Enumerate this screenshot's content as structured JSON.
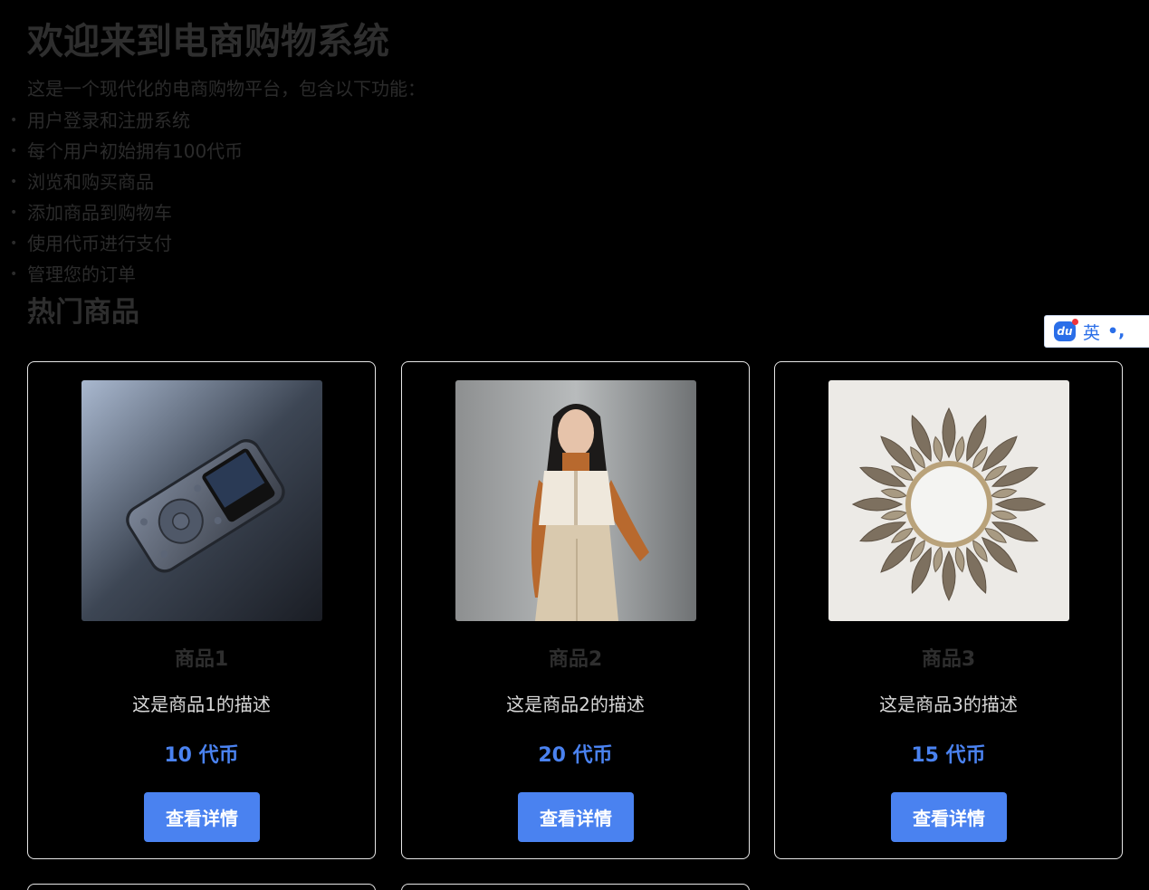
{
  "hero": {
    "title": "欢迎来到电商购物系统",
    "intro": "这是一个现代化的电商购物平台，包含以下功能：",
    "features": [
      "用户登录和注册系统",
      "每个用户初始拥有100代币",
      "浏览和购买商品",
      "添加商品到购物车",
      "使用代币进行支付",
      "管理您的订单"
    ]
  },
  "section": {
    "title": "热门商品"
  },
  "ime": {
    "logo": "du",
    "lang": "英",
    "punct": "•,"
  },
  "products": [
    {
      "name": "商品1",
      "description": "这是商品1的描述",
      "price": "10 代币",
      "button": "查看详情",
      "image_icon": "mp3-player-image"
    },
    {
      "name": "商品2",
      "description": "这是商品2的描述",
      "price": "20 代币",
      "button": "查看详情",
      "image_icon": "fashion-model-image"
    },
    {
      "name": "商品3",
      "description": "这是商品3的描述",
      "price": "15 代币",
      "button": "查看详情",
      "image_icon": "sunburst-mirror-image"
    }
  ],
  "colors": {
    "accent": "#4a82f0",
    "background": "#000000",
    "card_border": "#e6e6e6"
  }
}
